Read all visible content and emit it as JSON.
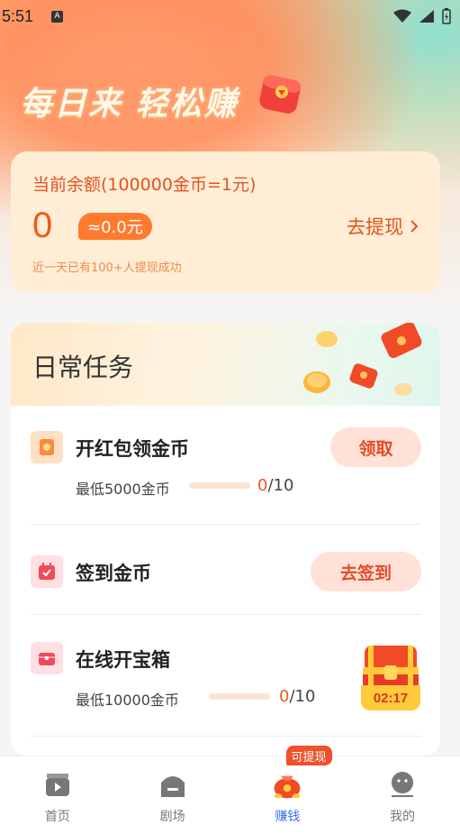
{
  "status_bar": {
    "time": "5:51",
    "a_label": "A"
  },
  "headline": "每日来 轻松赚",
  "balance": {
    "label": "当前余额(100000金币=1元)",
    "coins": "0",
    "cash": "≈0.0元",
    "withdraw_label": "去提现",
    "note": "近一天已有100+人提现成功"
  },
  "tasks": {
    "title": "日常任务",
    "items": [
      {
        "name": "开红包领金币",
        "sub": "最低5000金币",
        "current": "0",
        "total": "/10",
        "progress": 0,
        "button": "领取"
      },
      {
        "name": "签到金币",
        "button": "去签到"
      },
      {
        "name": "在线开宝箱",
        "sub": "最低10000金币",
        "current": "0",
        "total": "/10",
        "progress": 0,
        "timer": "02:17"
      }
    ]
  },
  "nav": {
    "items": [
      {
        "label": "首页",
        "icon": "clapper-icon"
      },
      {
        "label": "剧场",
        "icon": "theater-icon"
      },
      {
        "label": "赚钱",
        "icon": "money-bag-icon",
        "badge": "可提现"
      },
      {
        "label": "我的",
        "icon": "profile-icon"
      }
    ],
    "active_index": 2
  },
  "colors": {
    "accent": "#f05a1a",
    "active_nav": "#3a6cf4",
    "button_bg": "#ffe1d7"
  }
}
